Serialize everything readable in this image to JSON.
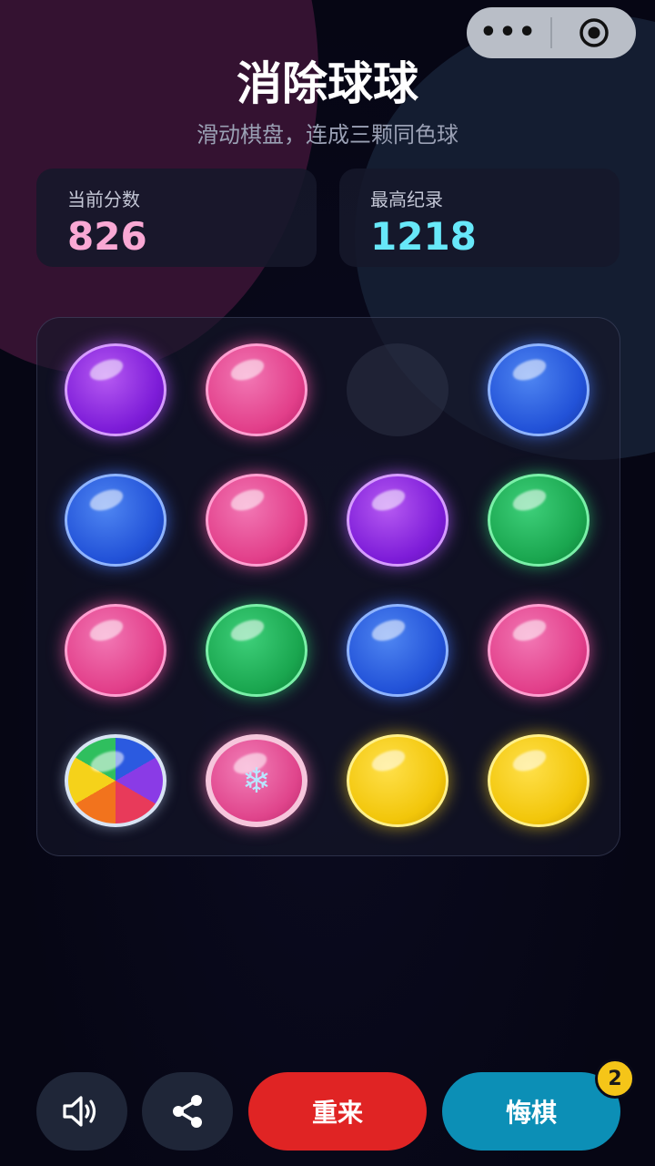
{
  "app": {
    "title": "消除球球",
    "subtitle": "滑动棋盘，连成三颗同色球"
  },
  "capsule": {
    "more_icon": "more-dots-icon",
    "close_icon": "target-icon"
  },
  "scores": {
    "current_label": "当前分数",
    "current_value": "826",
    "current_color": "#f9a8d4",
    "best_label": "最高纪录",
    "best_value": "1218",
    "best_color": "#67e8f9"
  },
  "board": {
    "rows": [
      [
        "purple",
        "pink",
        "empty",
        "blue"
      ],
      [
        "blue",
        "pink",
        "purple",
        "green"
      ],
      [
        "pink",
        "green",
        "blue",
        "pink"
      ],
      [
        "rainbow",
        "frozen-pink",
        "yellow",
        "yellow"
      ]
    ],
    "frozen_icon": "snowflake-icon"
  },
  "controls": {
    "sound_icon": "speaker-icon",
    "share_icon": "share-icon",
    "restart_label": "重来",
    "undo_label": "悔棋",
    "undo_count": "2"
  }
}
